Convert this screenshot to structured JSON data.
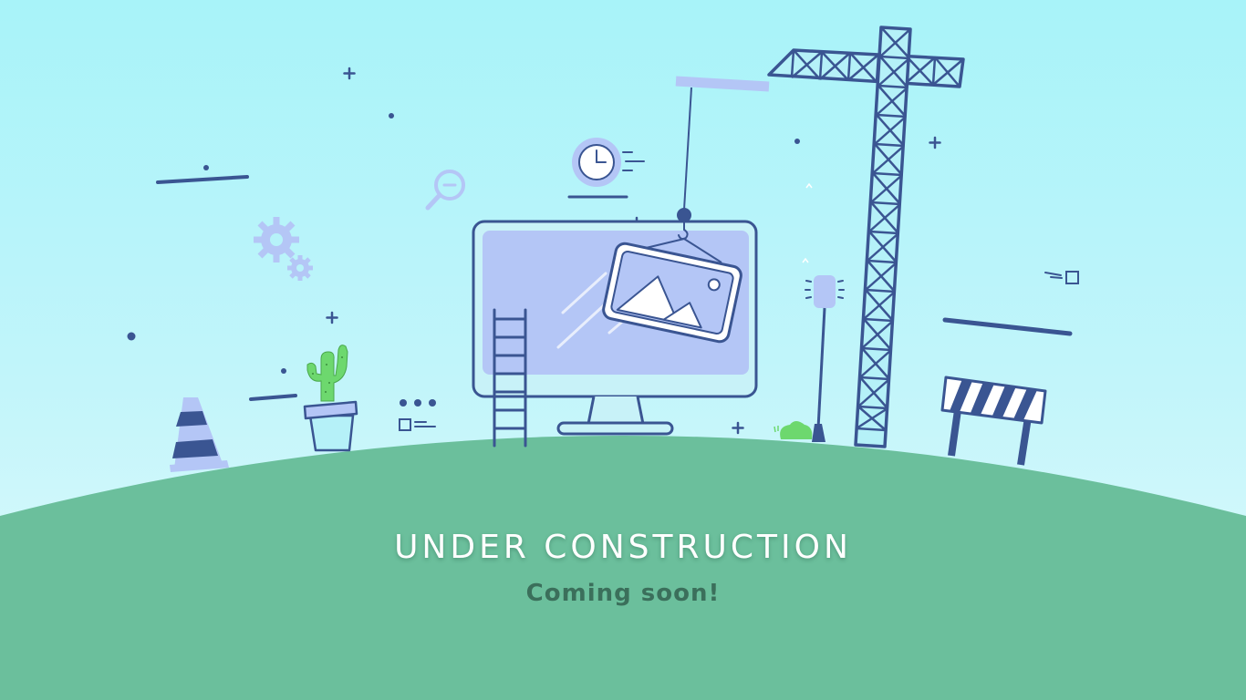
{
  "page": {
    "title": "UNDER CONSTRUCTION",
    "subtitle": "Coming soon!"
  },
  "colors": {
    "sky_top": "#a8f3f9",
    "sky_bottom": "#e2fbfd",
    "ground": "#6bbf9c",
    "navy": "#3a5592",
    "periwinkle": "#b4c6f6",
    "cactus_green": "#6dd86e",
    "title_text": "#ffffff",
    "subtitle_text": "#3b6f5b"
  },
  "illustration": {
    "icons": [
      "clock-icon",
      "magnifier-icon",
      "gear-icon",
      "crane-icon",
      "monitor-icon",
      "picture-icon",
      "ladder-icon",
      "cactus-icon",
      "traffic-cone-icon",
      "street-lamp-icon",
      "barrier-icon",
      "bush-icon"
    ]
  }
}
